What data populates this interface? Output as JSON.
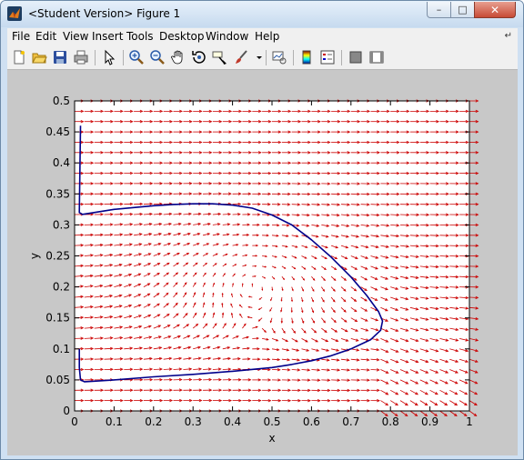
{
  "window": {
    "title": "<Student Version> Figure 1",
    "controls": {
      "minimize": "–",
      "maximize": "□",
      "close": "✕"
    }
  },
  "menubar": {
    "items": [
      "File",
      "Edit",
      "View",
      "Insert",
      "Tools",
      "Desktop",
      "Window",
      "Help"
    ],
    "corner_icon": "dock-arrow-icon"
  },
  "toolbar": {
    "buttons": [
      "new-figure-icon",
      "open-file-icon",
      "save-icon",
      "print-icon",
      "edit-plot-arrow-icon",
      "zoom-in-icon",
      "zoom-out-icon",
      "pan-hand-icon",
      "rotate-3d-icon",
      "data-cursor-icon",
      "brush-icon",
      "link-plot-icon",
      "colorbar-icon",
      "legend-icon",
      "hide-plot-tools-icon",
      "show-plot-tools-icon"
    ]
  },
  "colors": {
    "quiver": "#cc0000",
    "curve": "#00008b",
    "axes_background": "#ffffff",
    "figure_background": "#c8c8c8"
  },
  "chart_data": {
    "type": "quiver",
    "xlabel": "x",
    "ylabel": "y",
    "xlim": [
      0,
      1
    ],
    "ylim": [
      0,
      0.5
    ],
    "xticks": [
      "0",
      "0.1",
      "0.2",
      "0.3",
      "0.4",
      "0.5",
      "0.6",
      "0.7",
      "0.8",
      "0.9",
      "1"
    ],
    "yticks": [
      "0",
      "0.05",
      "0.1",
      "0.15",
      "0.2",
      "0.25",
      "0.3",
      "0.35",
      "0.4",
      "0.45",
      "0.5"
    ],
    "grid": false,
    "legend": "none",
    "series": [
      {
        "kind": "vector-field",
        "x_range": [
          0,
          1
        ],
        "y_range": [
          0,
          0.5
        ],
        "columns": 41,
        "rows": 31
      },
      {
        "kind": "trajectory",
        "points": [
          [
            0.015,
            0.46
          ],
          [
            0.012,
            0.32
          ],
          [
            0.02,
            0.317
          ],
          [
            0.06,
            0.321
          ],
          [
            0.1,
            0.325
          ],
          [
            0.15,
            0.328
          ],
          [
            0.2,
            0.331
          ],
          [
            0.25,
            0.333
          ],
          [
            0.3,
            0.334
          ],
          [
            0.35,
            0.334
          ],
          [
            0.4,
            0.332
          ],
          [
            0.45,
            0.327
          ],
          [
            0.5,
            0.316
          ],
          [
            0.55,
            0.3
          ],
          [
            0.6,
            0.276
          ],
          [
            0.65,
            0.248
          ],
          [
            0.7,
            0.216
          ],
          [
            0.74,
            0.186
          ],
          [
            0.77,
            0.16
          ],
          [
            0.78,
            0.145
          ],
          [
            0.775,
            0.13
          ],
          [
            0.75,
            0.115
          ],
          [
            0.7,
            0.1
          ],
          [
            0.65,
            0.089
          ],
          [
            0.6,
            0.081
          ],
          [
            0.55,
            0.075
          ],
          [
            0.5,
            0.07
          ],
          [
            0.4,
            0.064
          ],
          [
            0.3,
            0.059
          ],
          [
            0.2,
            0.055
          ],
          [
            0.1,
            0.05
          ],
          [
            0.05,
            0.048
          ],
          [
            0.025,
            0.047
          ],
          [
            0.015,
            0.05
          ],
          [
            0.012,
            0.07
          ],
          [
            0.012,
            0.1
          ]
        ]
      }
    ]
  }
}
